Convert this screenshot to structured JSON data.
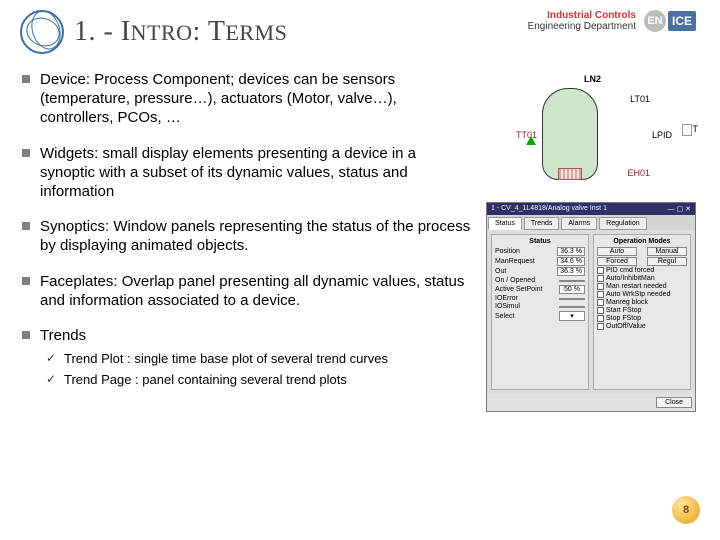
{
  "header": {
    "title_prefix": "1. - I",
    "title_intro": "NTRO",
    "title_sep": ": T",
    "title_terms": "ERMS",
    "dept_line1": "Industrial Controls",
    "dept_line2": "Engineering Department",
    "en": "EN",
    "ice": "ICE"
  },
  "bullets": {
    "b0": "Device:  Process Component; devices can be sensors (temperature, pressure…), actuators (Motor, valve…), controllers, PCOs, …",
    "b1": "Widgets:  small display elements presenting a device in a synoptic with a subset of its dynamic values, status and information",
    "b2": "Synoptics: Window panels representing the status of the process by displaying animated objects.",
    "b3": "Faceplates: Overlap panel presenting all dynamic values, status and information associated to a device.",
    "b4": "Trends",
    "b4s0": "Trend Plot : single time base plot of several trend curves",
    "b4s1": "Trend Page : panel containing several trend plots"
  },
  "widget": {
    "ln2": "LN2",
    "lt01": "LT01",
    "tt01": "TT01",
    "pid": "LPID",
    "eh01": "EH01",
    "t": "T"
  },
  "panel": {
    "title": "1 - CV_4_1L4818/Analog valve Inst 1",
    "tabs": [
      "Status",
      "Trends",
      "Alarms",
      "Regulation"
    ],
    "grp_status": "Status",
    "grp_modes": "Operation Modes",
    "rows_status": [
      {
        "l": "Position",
        "v": "36.3 %"
      },
      {
        "l": "ManRequest",
        "v": "34.6 %"
      },
      {
        "l": "Out",
        "v": "36.3 %"
      },
      {
        "l": "On / Opened",
        "v": ""
      },
      {
        "l": "Active SetPoint",
        "v": "50 %"
      },
      {
        "l": "IOError",
        "v": ""
      },
      {
        "l": "IOSimul",
        "v": ""
      }
    ],
    "mode_btns": [
      "Auto",
      "Manual",
      "Forced",
      "Regul"
    ],
    "checks": [
      "PID cmd forced",
      "Auto/InhibitMan",
      "Man restart needed",
      "Auto WrkStp needed",
      "Manreg block",
      "Start FStop",
      "Stop FStop",
      "OutOff/Value"
    ],
    "select_label": "Select",
    "close": "Close"
  },
  "page": "8"
}
